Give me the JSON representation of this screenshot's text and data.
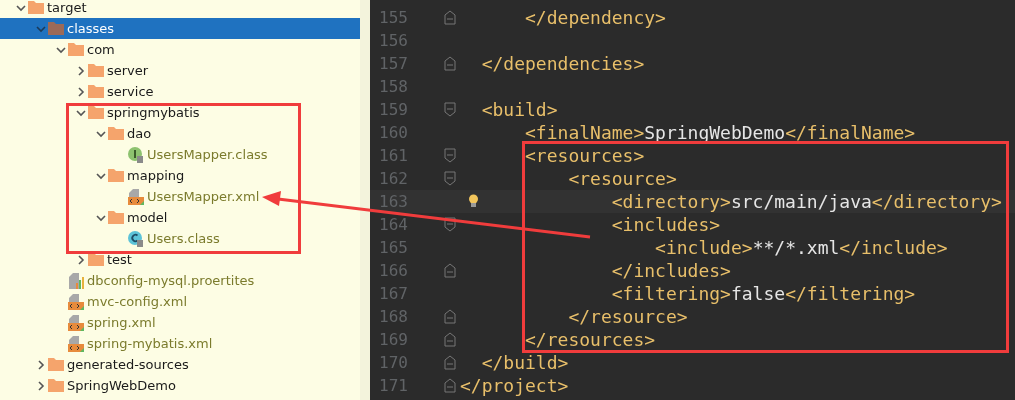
{
  "project_tree": {
    "items": [
      {
        "label": "target",
        "kind": "folder",
        "expanded": true,
        "selected": false,
        "children": [
          {
            "label": "classes",
            "kind": "folder",
            "expanded": true,
            "selected": true,
            "children": [
              {
                "label": "com",
                "kind": "folder",
                "expanded": true,
                "selected": false,
                "children": [
                  {
                    "label": "server",
                    "kind": "folder",
                    "expanded": false,
                    "selected": false
                  },
                  {
                    "label": "service",
                    "kind": "folder",
                    "expanded": false,
                    "selected": false
                  },
                  {
                    "label": "springmybatis",
                    "kind": "folder",
                    "expanded": true,
                    "selected": false,
                    "children": [
                      {
                        "label": "dao",
                        "kind": "folder",
                        "expanded": true,
                        "selected": false,
                        "children": [
                          {
                            "label": "UsersMapper.class",
                            "kind": "interface",
                            "selected": false
                          }
                        ]
                      },
                      {
                        "label": "mapping",
                        "kind": "folder",
                        "expanded": true,
                        "selected": false,
                        "children": [
                          {
                            "label": "UsersMapper.xml",
                            "kind": "xml",
                            "selected": false
                          }
                        ]
                      },
                      {
                        "label": "model",
                        "kind": "folder",
                        "expanded": true,
                        "selected": false,
                        "children": [
                          {
                            "label": "Users.class",
                            "kind": "class",
                            "selected": false
                          }
                        ]
                      }
                    ]
                  },
                  {
                    "label": "test",
                    "kind": "folder",
                    "expanded": false,
                    "selected": false
                  }
                ]
              },
              {
                "label": "dbconfig-mysql.proertites",
                "kind": "properties",
                "selected": false
              },
              {
                "label": "mvc-config.xml",
                "kind": "xml",
                "selected": false
              },
              {
                "label": "spring.xml",
                "kind": "xml",
                "selected": false
              },
              {
                "label": "spring-mybatis.xml",
                "kind": "xml",
                "selected": false
              }
            ]
          },
          {
            "label": "generated-sources",
            "kind": "folder",
            "expanded": false,
            "selected": false
          },
          {
            "label": "SpringWebDemo",
            "kind": "folder",
            "expanded": false,
            "selected": false
          }
        ]
      }
    ]
  },
  "editor": {
    "lines": [
      {
        "number": "155",
        "kind": "closer",
        "current": false,
        "bulb": false,
        "tokens": [
          {
            "kind": "tag",
            "text": "      </dependency>"
          }
        ]
      },
      {
        "number": "156",
        "kind": "plain",
        "current": false,
        "bulb": false
      },
      {
        "number": "157",
        "kind": "closer",
        "current": false,
        "bulb": false,
        "tokens": [
          {
            "kind": "tag",
            "text": "  </dependencies>"
          }
        ]
      },
      {
        "number": "158",
        "kind": "plain",
        "current": false,
        "bulb": false
      },
      {
        "number": "159",
        "kind": "opener",
        "current": false,
        "bulb": false,
        "tokens": [
          {
            "kind": "tag",
            "text": "  <build>"
          }
        ]
      },
      {
        "number": "160",
        "kind": "plain",
        "current": false,
        "bulb": false,
        "tokens": [
          {
            "kind": "tag",
            "text": "      <finalName>"
          },
          {
            "kind": "text",
            "text": "SpringWebDemo"
          },
          {
            "kind": "tag",
            "text": "</finalName>"
          }
        ]
      },
      {
        "number": "161",
        "kind": "opener",
        "current": false,
        "bulb": false,
        "tokens": [
          {
            "kind": "tag",
            "text": "      <resources>"
          }
        ]
      },
      {
        "number": "162",
        "kind": "opener",
        "current": false,
        "bulb": false,
        "tokens": [
          {
            "kind": "tag",
            "text": "          <resource>"
          }
        ]
      },
      {
        "number": "163",
        "kind": "plain",
        "current": true,
        "bulb": true,
        "tokens": [
          {
            "kind": "tag",
            "text": "              <directory>"
          },
          {
            "kind": "text",
            "text": "src/main/java"
          },
          {
            "kind": "tag",
            "text": "</directory>"
          }
        ]
      },
      {
        "number": "164",
        "kind": "opener",
        "current": false,
        "bulb": false,
        "tokens": [
          {
            "kind": "tag",
            "text": "              <includes>"
          }
        ]
      },
      {
        "number": "165",
        "kind": "plain",
        "current": false,
        "bulb": false,
        "tokens": [
          {
            "kind": "tag",
            "text": "                  <include>"
          },
          {
            "kind": "text",
            "text": "**/*.xml"
          },
          {
            "kind": "tag",
            "text": "</include>"
          }
        ]
      },
      {
        "number": "166",
        "kind": "closer",
        "current": false,
        "bulb": false,
        "tokens": [
          {
            "kind": "tag",
            "text": "              </includes>"
          }
        ]
      },
      {
        "number": "167",
        "kind": "plain",
        "current": false,
        "bulb": false,
        "tokens": [
          {
            "kind": "tag",
            "text": "              <filtering>"
          },
          {
            "kind": "text",
            "text": "false"
          },
          {
            "kind": "tag",
            "text": "</filtering>"
          }
        ]
      },
      {
        "number": "168",
        "kind": "closer",
        "current": false,
        "bulb": false,
        "tokens": [
          {
            "kind": "tag",
            "text": "          </resource>"
          }
        ]
      },
      {
        "number": "169",
        "kind": "closer",
        "current": false,
        "bulb": false,
        "tokens": [
          {
            "kind": "tag",
            "text": "      </resources>"
          }
        ]
      },
      {
        "number": "170",
        "kind": "closer",
        "current": false,
        "bulb": false,
        "tokens": [
          {
            "kind": "tag",
            "text": "  </build>"
          }
        ]
      },
      {
        "number": "171",
        "kind": "closer",
        "current": false,
        "bulb": false,
        "tokens": [
          {
            "kind": "tag",
            "text": "</project>"
          }
        ]
      }
    ]
  }
}
